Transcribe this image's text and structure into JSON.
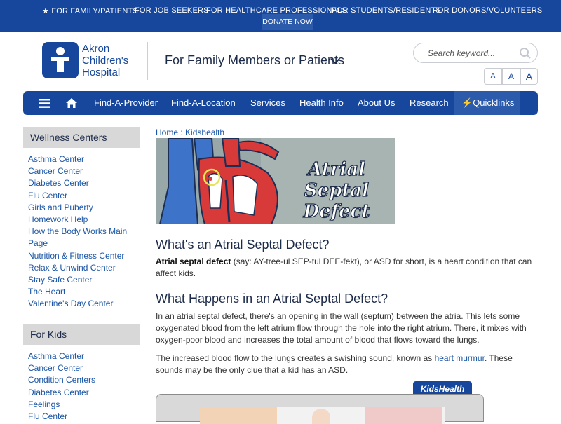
{
  "utility": {
    "family": "FOR FAMILY/PATIENTS",
    "job": "FOR JOB SEEKERS",
    "pros": "FOR HEALTHCARE PROFESSIONALS",
    "students": "FOR STUDENTS/RESIDENTS",
    "donors": "FOR DONORS/VOLUNTEERS",
    "donate": "DONATE NOW"
  },
  "header": {
    "logo_line1": "Akron",
    "logo_line2": "Children's",
    "logo_line3": "Hospital",
    "audience": "For Family Members or Patients",
    "search_placeholder": "Search keyword...",
    "text_sizes": [
      "A",
      "A",
      "A"
    ]
  },
  "nav": {
    "items": [
      "Find-A-Provider",
      "Find-A-Location",
      "Services",
      "Health Info",
      "About Us",
      "Research"
    ],
    "quicklinks": "Quicklinks"
  },
  "sidebar": {
    "wellness_title": "Wellness Centers",
    "wellness": [
      "Asthma Center",
      "Cancer Center",
      "Diabetes Center",
      "Flu Center",
      "Girls and Puberty",
      "Homework Help",
      "How the Body Works Main Page",
      "Nutrition & Fitness Center",
      "Relax & Unwind Center",
      "Stay Safe Center",
      "The Heart",
      "Valentine's Day Center"
    ],
    "kids_title": "For Kids",
    "kids": [
      "Asthma Center",
      "Cancer Center",
      "Condition Centers",
      "Diabetes Center",
      "Feelings",
      "Flu Center"
    ]
  },
  "content": {
    "breadcrumb_home": "Home",
    "breadcrumb_sep": ":",
    "breadcrumb_current": "Kidshealth",
    "hero_line1": "Atrial Septal",
    "hero_line2": "Defect",
    "h1": "What's an Atrial Septal Defect?",
    "p1_bold": "Atrial septal defect",
    "p1_rest": " (say: AY-tree-ul SEP-tul DEE-fekt), or ASD for short, is a heart condition that can affect kids.",
    "h2": "What Happens in an Atrial Septal Defect?",
    "p2": "In an atrial septal defect, there's an opening in the wall (septum) between the atria. This lets some oxygenated blood from the left atrium flow through the hole into the right atrium. There, it mixes with oxygen-poor blood and increases the total amount of blood that flows toward the lungs.",
    "p3_a": "The increased blood flow to the lungs creates a swishing sound, known as ",
    "p3_link": "heart murmur",
    "p3_b": ". These sounds may be the only clue that a kid has an ASD.",
    "badge": "KidsHealth"
  },
  "colors": {
    "brand": "#16479c",
    "link": "#1a55a6",
    "sidebar_head": "#d8d8d8"
  }
}
